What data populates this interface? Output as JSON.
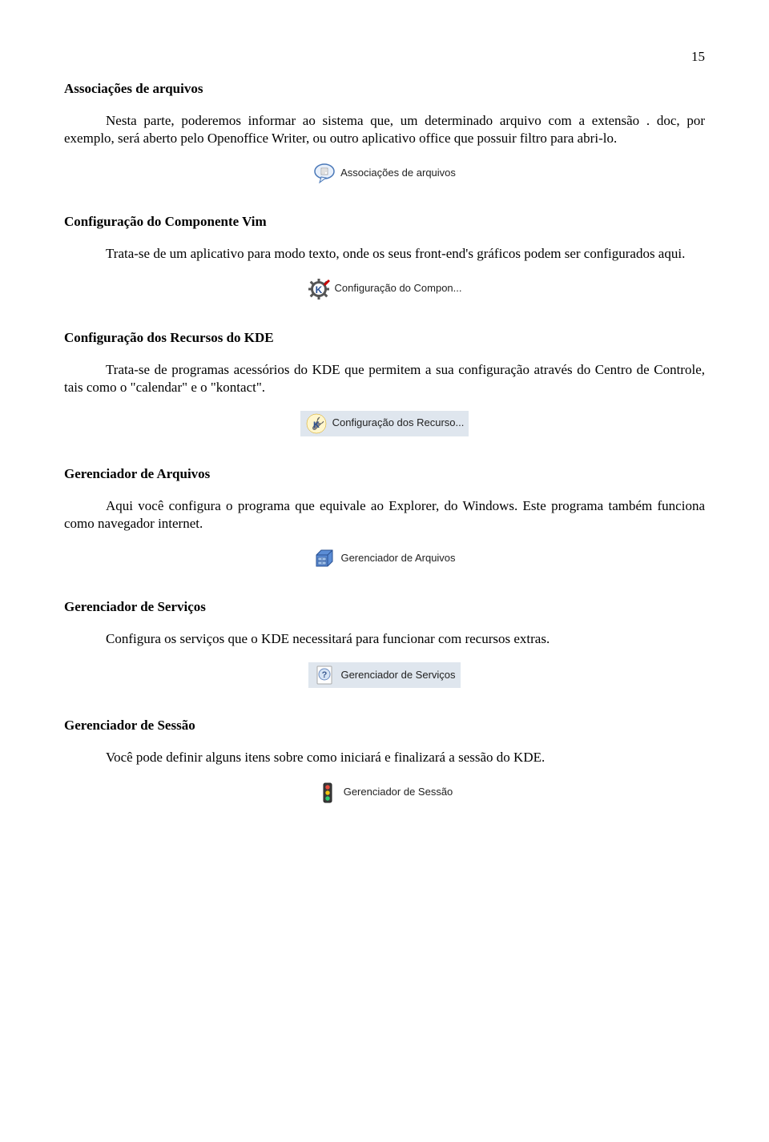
{
  "page_number": "15",
  "sections": [
    {
      "heading": "Associações de arquivos",
      "paragraph": "Nesta parte, poderemos informar ao sistema que, um determinado arquivo com a extensão . doc, por exemplo, será aberto pelo Openoffice Writer, ou outro aplicativo office que possuir filtro para abri-lo.",
      "icon_label": "Associações de arquivos",
      "icon_name": "speech-bubble-icon",
      "highlight": false
    },
    {
      "heading": "Configuração do Componente Vim",
      "paragraph": "Trata-se de um aplicativo para modo texto, onde os seus front-end's gráficos podem ser configurados aqui.",
      "icon_label": "Configuração do Compon...",
      "icon_name": "gear-k-icon",
      "highlight": false
    },
    {
      "heading": "Configuração dos Recursos do KDE",
      "paragraph": "Trata-se de programas acessórios do KDE que permitem a sua configuração através do Centro de Controle, tais como o \"calendar\" e o \"kontact\".",
      "icon_label": "Configuração dos Recurso...",
      "icon_name": "wrench-k-icon",
      "highlight": true
    },
    {
      "heading": "Gerenciador de Arquivos",
      "paragraph": "Aqui você configura o programa que equivale ao Explorer, do Windows. Este programa também funciona como navegador internet.",
      "icon_label": "Gerenciador de Arquivos",
      "icon_name": "drawer-icon",
      "highlight": false
    },
    {
      "heading": "Gerenciador de Serviços",
      "paragraph": "Configura os serviços que o KDE necessitará para funcionar com recursos extras.",
      "icon_label": "Gerenciador de Serviços",
      "icon_name": "question-page-icon",
      "highlight": true
    },
    {
      "heading": "Gerenciador de Sessão",
      "paragraph": "Você pode definir alguns itens sobre como iniciará e finalizará a sessão do KDE.",
      "icon_label": "Gerenciador de Sessão",
      "icon_name": "traffic-light-icon",
      "highlight": false
    }
  ]
}
